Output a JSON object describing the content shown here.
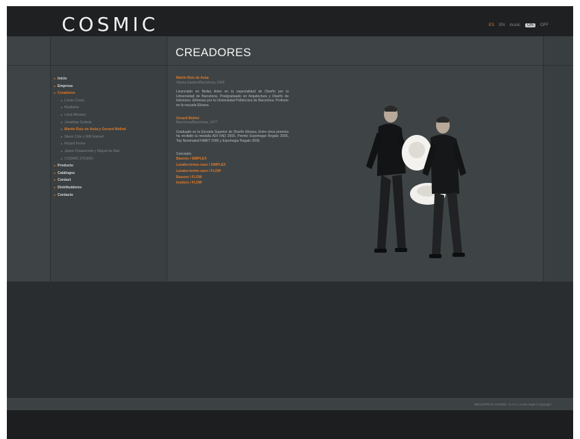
{
  "header": {
    "logo": "COSMIC",
    "languages": [
      {
        "label": "ES",
        "active": true
      },
      {
        "label": "EN",
        "active": false
      }
    ],
    "music_label": "music",
    "music_toggle": "ON",
    "music_state": "OFF"
  },
  "main": {
    "title": "CREADORES"
  },
  "nav": {
    "items": [
      {
        "label": "Inicio",
        "type": "main",
        "active": false
      },
      {
        "label": "Empresa",
        "type": "main",
        "active": false
      },
      {
        "label": "Creadores",
        "type": "main",
        "active": true
      },
      {
        "label": "Lucas Cross",
        "type": "sub",
        "active": false
      },
      {
        "label": "Basiliana",
        "type": "sub",
        "active": false
      },
      {
        "label": "Llorá Mesano",
        "type": "sub",
        "active": false
      },
      {
        "label": "Jonathan Gottola",
        "type": "sub",
        "active": false
      },
      {
        "label": "Martín Ruiz de Azúa y Gerard Moliné",
        "type": "sub",
        "active": true
      },
      {
        "label": "Nieve Cole y Will Hunnel",
        "type": "sub",
        "active": false
      },
      {
        "label": "Ricard Ferrer",
        "type": "sub",
        "active": false
      },
      {
        "label": "Jaime Chiaberretti y Miquel de Mal",
        "type": "sub",
        "active": false
      },
      {
        "label": "COSMIC STUDIO",
        "type": "sub",
        "active": false
      },
      {
        "label": "Producto",
        "type": "main",
        "active": false
      },
      {
        "label": "Catálogos",
        "type": "main",
        "active": false
      },
      {
        "label": "Contact",
        "type": "main",
        "active": false
      },
      {
        "label": "Distribuidores",
        "type": "main",
        "active": false
      },
      {
        "label": "Contacto",
        "type": "main",
        "active": false
      }
    ]
  },
  "bio": {
    "name1": "Martín Ruiz de Azúa",
    "info1": "Vitoria-Gasteiz/Barcelona, 1965",
    "para1": "Licenciado en Bellas Artes en la especialidad de Diseño por la Universidad de Barcelona. Postgraduado en Arquitectura y Diseño de Interiores. Efímeras por la Universidad Politécnica de Barcelona. Profesor en la escuela Elisava.",
    "name2": "Gerard Moliné",
    "info2": "Barcelona/Barcelona, 1977",
    "para2": "Graduado en la Escuela Superior de Diseño Elisava. Entre otros premios ha recibido la medalla ADI FAD 2005, Premio Expohogar Regalo 2005, Top Nominated HABIT 2005 y Expohogar Regalo 2006.",
    "label": "Concepto:",
    "links": [
      "Basono / SIMPLEX",
      "Lavabo-termo-caso / SIMPLEX",
      "Lavabo-termo-caso / FLOW",
      "Basono / FLOW",
      "Inodoro / FLOW"
    ]
  },
  "footer": {
    "links": "INDUSTRIAS COSMIC, S.A.U.  |  Aviso legal  |  Copyright"
  },
  "colors": {
    "accent": "#e07a2a",
    "background": "#3e4446",
    "header": "#1e2022"
  }
}
